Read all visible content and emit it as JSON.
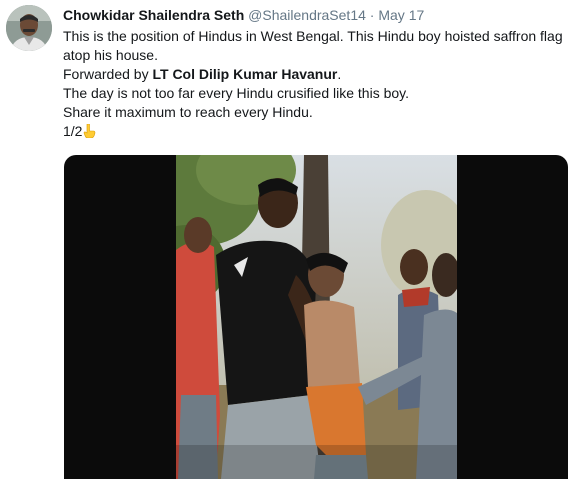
{
  "tweet": {
    "author_name": "Chowkidar Shailendra Seth",
    "handle": "@ShailendraSet14",
    "separator": "·",
    "date": "May 17",
    "line1": "This is the position of Hindus in West Bengal. This Hindu boy hoisted saffron flag atop his house.",
    "forwarded_prefix": "Forwarded by ",
    "forwarded_name": "LT Col Dilip Kumar Havanur",
    "forwarded_suffix": ".",
    "line3": "The day is not too far every Hindu crusified like this boy.",
    "line4": "Share it maximum to reach every Hindu.",
    "counter": "1/2",
    "counter_emoji": "backhand-index-pointing-down-icon"
  },
  "colors": {
    "text": "#14171a",
    "secondary": "#657786",
    "media_background": "#0b0b0b"
  }
}
